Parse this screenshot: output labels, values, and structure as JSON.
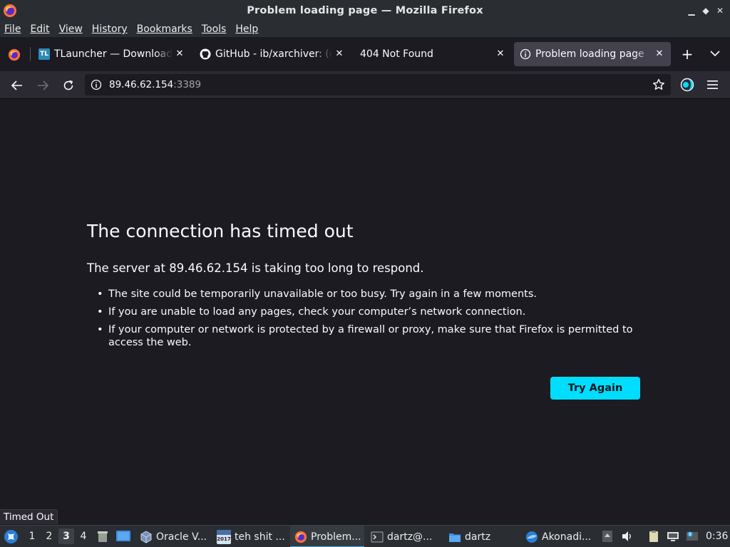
{
  "window": {
    "title": "Problem loading page — Mozilla Firefox",
    "controls": {
      "minimize": "▁",
      "restore": "◆",
      "close": "✕"
    }
  },
  "menu": [
    "File",
    "Edit",
    "View",
    "History",
    "Bookmarks",
    "Tools",
    "Help"
  ],
  "tabs": [
    {
      "label": "TLauncher — Download Minecraft",
      "favicon": "tlauncher-icon",
      "active": false
    },
    {
      "label": "GitHub - ib/xarchiver: (co",
      "favicon": "github-icon",
      "active": false
    },
    {
      "label": "404 Not Found",
      "favicon": "",
      "active": false
    },
    {
      "label": "Problem loading page",
      "favicon": "info-icon",
      "active": true
    }
  ],
  "tlauncher_badge": "TL",
  "urlbar": {
    "host": "89.46.62.154",
    "port": ":3389"
  },
  "error": {
    "title": "The connection has timed out",
    "description": "The server at 89.46.62.154 is taking too long to respond.",
    "items": [
      "The site could be temporarily unavailable or too busy. Try again in a few moments.",
      "If you are unable to load any pages, check your computer’s network connection.",
      "If your computer or network is protected by a firewall or proxy, make sure that Firefox is permitted to access the web."
    ],
    "button": "Try Again"
  },
  "status_text": "Timed Out",
  "taskbar": {
    "desktops": [
      "1",
      "2",
      "3",
      "4"
    ],
    "active_desktop": "3",
    "items": [
      {
        "label": "Oracle V...",
        "icon": "virtualbox-icon"
      },
      {
        "label": "teh shit ...",
        "icon": "calendar-app-icon"
      },
      {
        "label": "Problem...",
        "icon": "firefox-icon"
      },
      {
        "label": "dartz@...",
        "icon": "terminal-icon"
      },
      {
        "label": "dartz",
        "icon": "folder-icon"
      },
      {
        "label": "Akonadi...",
        "icon": "akonadi-icon"
      }
    ],
    "calendar_badge": "2017",
    "clock": "0:36"
  },
  "colors": {
    "accent_button": "#00ddff",
    "page_bg": "#1c1b22",
    "toolbar_bg": "#2b2a33",
    "active_tab_bg": "#42414d",
    "taskbar_active": "#3daee9"
  }
}
